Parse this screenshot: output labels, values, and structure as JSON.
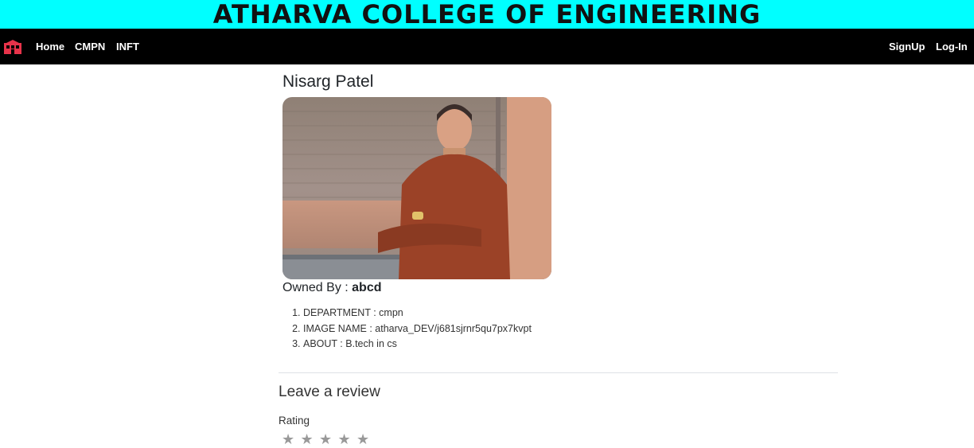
{
  "banner": {
    "title": "ATHARVA COLLEGE OF ENGINEERING",
    "background": "#00ffff"
  },
  "navbar": {
    "logo_icon": "building-icon",
    "left_links": [
      "Home",
      "CMPN",
      "INFT"
    ],
    "right_links": [
      "SignUp",
      "Log-In"
    ],
    "background": "#000000"
  },
  "profile": {
    "name": "Nisarg Patel",
    "owned_by_label": "Owned By :",
    "owner": "abcd",
    "details": [
      "DEPARTMENT : cmpn",
      "IMAGE NAME : atharva_DEV/j681sjrnr5qu7px7kvpt",
      "ABOUT : B.tech in cs"
    ]
  },
  "review": {
    "heading": "Leave a review",
    "rating_label": "Rating",
    "stars": [
      "★",
      "★",
      "★",
      "★",
      "★"
    ]
  }
}
